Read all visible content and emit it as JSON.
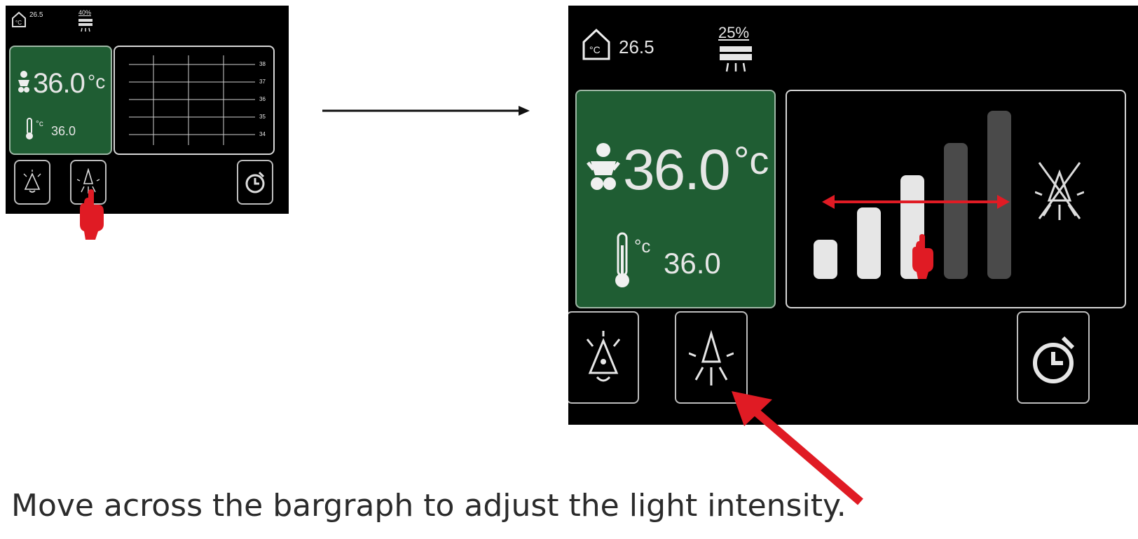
{
  "small_screen": {
    "room_temp": "26.5",
    "humidity": "40%",
    "baby_temp": "36.0",
    "baby_unit": "°c",
    "set_temp_unit": "°c",
    "set_temp": "36.0",
    "chart_scale": [
      "38",
      "37",
      "36",
      "35",
      "34"
    ]
  },
  "large_screen": {
    "room_temp": "26.5",
    "humidity": "25%",
    "baby_temp": "36.0",
    "baby_unit": "°c",
    "set_temp_unit": "°c",
    "set_temp": "36.0",
    "light_level": {
      "current": 3,
      "max": 5
    }
  },
  "caption": "Move across the bargraph to adjust the light intensity.",
  "colors": {
    "screen_bg": "#000000",
    "panel_green": "#1f5d33",
    "bar_active": "#e6e6e6",
    "bar_inactive": "#4a4a4a",
    "highlight_red": "#e01b24"
  },
  "icons": [
    "home-thermometer-icon",
    "humidifier-icon",
    "baby-icon",
    "thermometer-icon",
    "alarm-bell-icon",
    "light-bulb-icon",
    "timer-icon",
    "light-off-icon",
    "hand-pointer-icon",
    "arrow-icon"
  ]
}
